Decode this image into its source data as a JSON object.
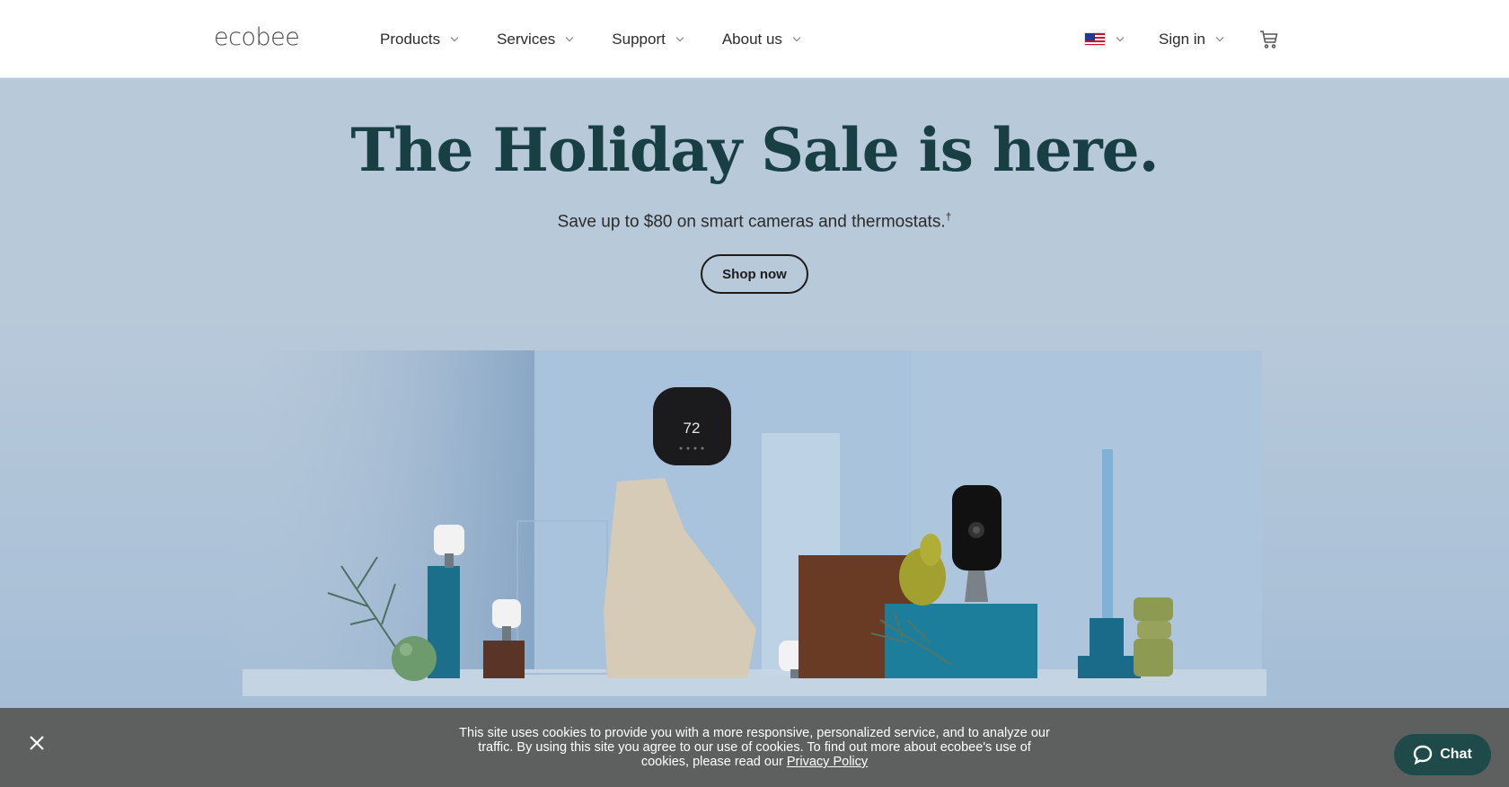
{
  "header": {
    "logo": "ecobee",
    "nav": [
      "Products",
      "Services",
      "Support",
      "About us"
    ],
    "locale_flag": "us-flag-icon",
    "sign_in": "Sign in",
    "cart_icon": "cart-icon"
  },
  "hero": {
    "title": "The Holiday Sale is here.",
    "subtitle": "Save up to $80 on smart cameras and thermostats.",
    "subtitle_mark": "†",
    "cta": "Shop now",
    "thermostat_reading": "72",
    "colors": {
      "background": "#b8c9da",
      "title": "#173f44"
    }
  },
  "cookie_banner": {
    "text": "This site uses cookies to provide you with a more responsive, personalized service, and to analyze our traffic. By using this site you agree to our use of cookies. To find out more about ecobee's use of cookies, please read our",
    "link": "Privacy Policy",
    "close_icon": "close-icon"
  },
  "chat": {
    "label": "Chat",
    "icon": "chat-bubble-icon",
    "color": "#1e4b4a"
  }
}
